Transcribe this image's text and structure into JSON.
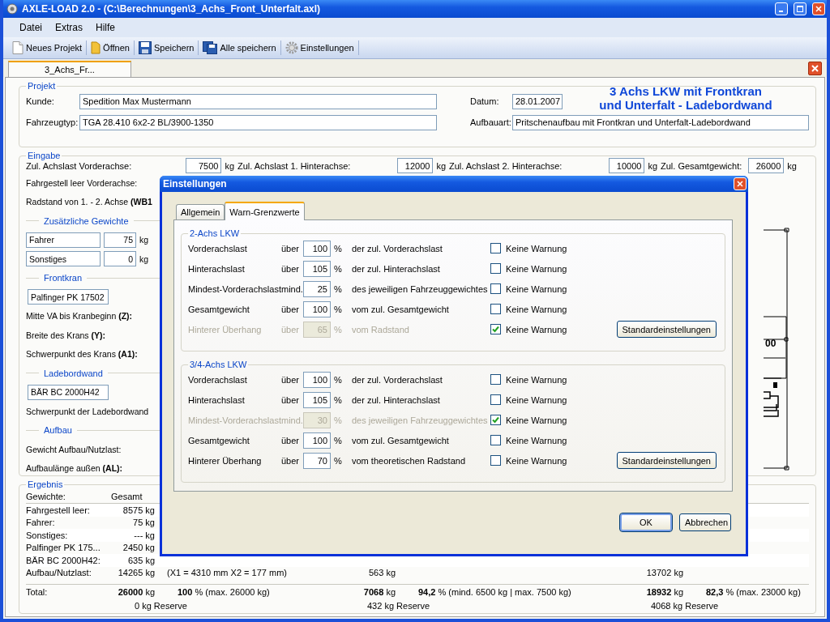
{
  "window": {
    "title": "AXLE-LOAD 2.0 - (C:\\Berechnungen\\3_Achs_Front_Unterfalt.axl)"
  },
  "menu": [
    "Datei",
    "Extras",
    "Hilfe"
  ],
  "toolbar": [
    {
      "label": "Neues Projekt",
      "kind": "page"
    },
    {
      "label": "Öffnen",
      "kind": "folder"
    },
    {
      "label": "Speichern",
      "kind": "disk"
    },
    {
      "label": "Alle speichern",
      "kind": "disks"
    },
    {
      "label": "Einstellungen",
      "kind": "gear"
    }
  ],
  "document_tabs": [
    {
      "label": "3_Achs_Fr...",
      "selected": true
    }
  ],
  "project": {
    "title": "Projekt",
    "customer": {
      "label": "Kunde:",
      "value": "Spedition Max Mustermann"
    },
    "vehicle_type": {
      "label": "Fahrzeugtyp:",
      "value": "TGA 28.410 6x2-2 BL/3900-1350"
    },
    "date": {
      "label": "Datum:",
      "value": "28.01.2007"
    },
    "body_type": {
      "label": "Aufbauart:",
      "value": "Pritschenaufbau mit Frontkran und Unterfalt-Ladebordwand"
    },
    "heading": [
      "3 Achs LKW mit Frontkran",
      "und Unterfalt - Ladebordwand"
    ]
  },
  "input": {
    "title": "Eingabe",
    "axle_limits": [
      {
        "label": "Zul. Achslast Vorderachse:",
        "value": "7500",
        "unit": "kg"
      },
      {
        "label": "Zul. Achslast 1. Hinterachse:",
        "value": "12000",
        "unit": "kg"
      },
      {
        "label": "Zul. Achslast 2. Hinterachse:",
        "value": "10000",
        "unit": "kg"
      },
      {
        "label": "Zul. Gesamtgewicht:",
        "value": "26000",
        "unit": "kg"
      }
    ],
    "items": [
      {
        "kind": "label",
        "text": "Fahrgestell leer Vorderachse:"
      },
      {
        "kind": "label",
        "text": "Radstand von 1. - 2. Achse **(WB1**"
      },
      {
        "kind": "section",
        "text": "Zusätzliche Gewichte"
      },
      {
        "kind": "weight",
        "name": "Fahrer",
        "value": "75",
        "unit": "kg"
      },
      {
        "kind": "weight",
        "name": "Sonstiges",
        "value": "0",
        "unit": "kg"
      },
      {
        "kind": "section",
        "text": "Frontkran"
      },
      {
        "kind": "field",
        "value": "Palfinger PK 17502"
      },
      {
        "kind": "label",
        "text": "Mitte VA bis Kranbeginn **(Z):**"
      },
      {
        "kind": "label",
        "text": "Breite des Krans  **(Y):**"
      },
      {
        "kind": "label",
        "text": "Schwerpunkt des Krans **(A1):**"
      },
      {
        "kind": "section",
        "text": "Ladebordwand"
      },
      {
        "kind": "field",
        "value": "BÄR BC 2000H42"
      },
      {
        "kind": "label",
        "text": "Schwerpunkt der Ladebordwand"
      },
      {
        "kind": "section",
        "text": "Aufbau"
      },
      {
        "kind": "label",
        "text": "Gewicht Aufbau/Nutzlast:"
      },
      {
        "kind": "label",
        "text": "Aufbaulänge außen **(AL):**"
      }
    ],
    "drawing_label": "00"
  },
  "result": {
    "title": "Ergebnis",
    "header": [
      "Gewichte:",
      "Gesamt"
    ],
    "rows": [
      {
        "label": "Fahrgestell leer:",
        "total": "8575 kg"
      },
      {
        "label": "Fahrer:",
        "total": "75 kg"
      },
      {
        "label": "Sonstiges:",
        "total": "---  kg"
      },
      {
        "label": "Palfinger PK 175...",
        "total": "2450 kg"
      },
      {
        "label": "BÄR BC 2000H42:",
        "total": "635 kg"
      },
      {
        "label": "Aufbau/Nutzlast:",
        "total": "14265 kg",
        "position": "(X1 = 4310 mm   X2 = 177 mm)",
        "front": "563 kg",
        "rear": "13702 kg"
      }
    ],
    "totals": {
      "label": "Total:",
      "groups": [
        {
          "value": "26000",
          "unit": "kg",
          "percent": "100",
          "percent_unit": "%",
          "limit": "(max. 26000 kg)"
        },
        {
          "value": "7068",
          "unit": "kg",
          "percent": "94,2",
          "percent_unit": "%",
          "limit": "(mind. 6500 kg | max. 7500 kg)"
        },
        {
          "value": "18932",
          "unit": "kg",
          "percent": "82,3",
          "percent_unit": "%",
          "limit": "(max. 23000 kg)"
        }
      ]
    },
    "reserves": [
      "0 kg Reserve",
      "432 kg Reserve",
      "4068 kg Reserve"
    ]
  },
  "dialog": {
    "title": "Einstellungen",
    "tabs": [
      {
        "label": "Allgemein",
        "selected": false
      },
      {
        "label": "Warn-Grenzwerte",
        "selected": true
      }
    ],
    "groups": [
      {
        "title": "2-Achs LKW",
        "reset_button": "Standardeinstellungen",
        "rows": [
          {
            "label": "Vorderachslast",
            "operator": "über",
            "value": "100",
            "unit": "%",
            "description": "der zul. Vorderachslast",
            "option": "Keine Warnung",
            "checked": false,
            "disabled": false
          },
          {
            "label": "Hinterachslast",
            "operator": "über",
            "value": "105",
            "unit": "%",
            "description": "der zul. Hinterachslast",
            "option": "Keine Warnung",
            "checked": false,
            "disabled": false
          },
          {
            "label": "Mindest-Vorderachslast",
            "operator": "mind.",
            "value": "25",
            "unit": "%",
            "description": "des jeweiligen Fahrzeuggewichtes",
            "option": "Keine Warnung",
            "checked": false,
            "disabled": false
          },
          {
            "label": "Gesamtgewicht",
            "operator": "über",
            "value": "100",
            "unit": "%",
            "description": "vom zul. Gesamtgewicht",
            "option": "Keine Warnung",
            "checked": false,
            "disabled": false
          },
          {
            "label": "Hinterer Überhang",
            "operator": "über",
            "value": "65",
            "unit": "%",
            "description": "vom Radstand",
            "option": "Keine Warnung",
            "checked": true,
            "disabled": true
          }
        ]
      },
      {
        "title": "3/4-Achs LKW",
        "reset_button": "Standardeinstellungen",
        "rows": [
          {
            "label": "Vorderachslast",
            "operator": "über",
            "value": "100",
            "unit": "%",
            "description": "der zul. Vorderachslast",
            "option": "Keine Warnung",
            "checked": false,
            "disabled": false
          },
          {
            "label": "Hinterachslast",
            "operator": "über",
            "value": "105",
            "unit": "%",
            "description": "der zul. Hinterachslast",
            "option": "Keine Warnung",
            "checked": false,
            "disabled": false
          },
          {
            "label": "Mindest-Vorderachslast",
            "operator": "mind.",
            "value": "30",
            "unit": "%",
            "description": "des jeweiligen Fahrzeuggewichtes",
            "option": "Keine Warnung",
            "checked": true,
            "disabled": true
          },
          {
            "label": "Gesamtgewicht",
            "operator": "über",
            "value": "100",
            "unit": "%",
            "description": "vom zul. Gesamtgewicht",
            "option": "Keine Warnung",
            "checked": false,
            "disabled": false
          },
          {
            "label": "Hinterer Überhang",
            "operator": "über",
            "value": "70",
            "unit": "%",
            "description": "vom theoretischen Radstand",
            "option": "Keine Warnung",
            "checked": false,
            "disabled": false
          }
        ]
      }
    ],
    "buttons": [
      "OK",
      "Abbrechen"
    ]
  }
}
